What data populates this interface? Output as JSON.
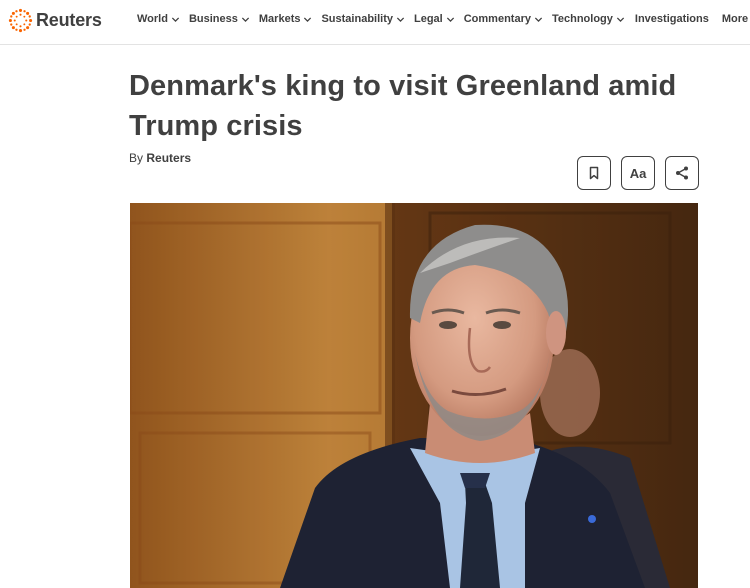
{
  "brand": {
    "name": "Reuters",
    "logo_icon": "reuters-dot-logo-icon",
    "accent": "#fa6400"
  },
  "nav": {
    "items": [
      {
        "label": "World",
        "has_menu": true
      },
      {
        "label": "Business",
        "has_menu": true
      },
      {
        "label": "Markets",
        "has_menu": true
      },
      {
        "label": "Sustainability",
        "has_menu": true
      },
      {
        "label": "Legal",
        "has_menu": true
      },
      {
        "label": "Commentary",
        "has_menu": true
      },
      {
        "label": "Technology",
        "has_menu": true
      },
      {
        "label": "Investigations",
        "has_menu": false
      },
      {
        "label": "More",
        "has_menu": true
      }
    ]
  },
  "article": {
    "headline_line1": "Denmark's king to visit Greenland amid",
    "headline_line2": "Trump crisis",
    "byline_prefix": "By",
    "byline_author": "Reuters",
    "tools": {
      "bookmark_icon": "bookmark-icon",
      "text_size_label": "Aa",
      "share_icon": "share-icon"
    }
  }
}
